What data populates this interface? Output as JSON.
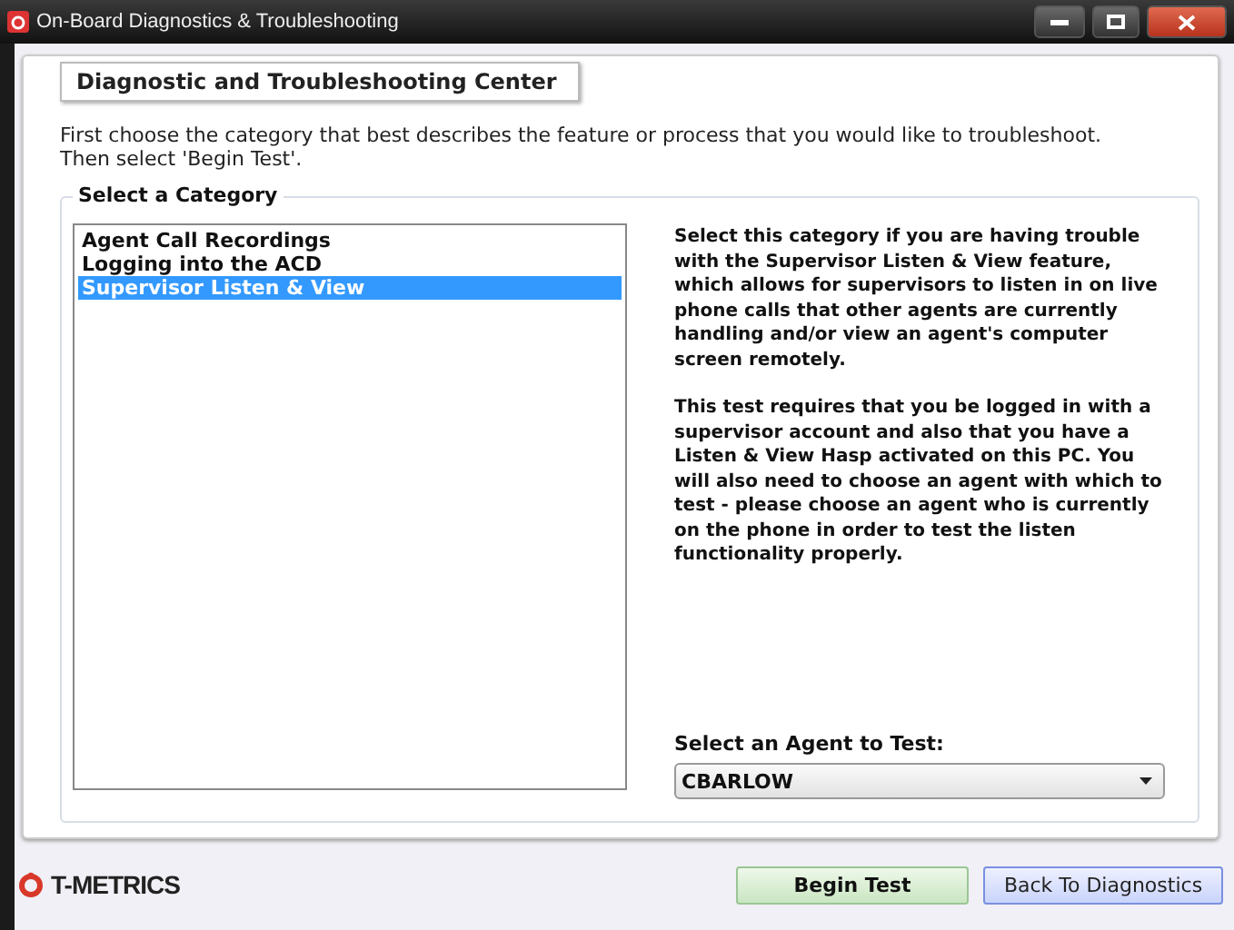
{
  "window": {
    "title": "On-Board Diagnostics & Troubleshooting"
  },
  "tab": {
    "label": "Diagnostic and Troubleshooting Center"
  },
  "intro": "First choose the category that best describes the feature or process that you would like to troubleshoot. Then select 'Begin Test'.",
  "category_group": {
    "title": "Select a Category",
    "items": [
      {
        "label": "Agent Call Recordings",
        "selected": false
      },
      {
        "label": "Logging into the ACD",
        "selected": false
      },
      {
        "label": "Supervisor Listen & View",
        "selected": true
      }
    ],
    "description": [
      "Select this category if you are having trouble with the Supervisor Listen & View feature, which allows for supervisors to listen in on live phone calls that other agents are currently handling and/or view an agent's computer screen remotely.",
      "This test requires that you be logged in with a supervisor account and also that you have a Listen & View Hasp activated on this PC.  You will also need to choose an agent with which to test - please choose an agent who is currently on the phone in order to test the listen functionality properly."
    ],
    "agent_label": "Select an Agent to Test:",
    "agent_value": "CBARLOW"
  },
  "footer": {
    "logo": "T-METRICS",
    "buttons": [
      {
        "label": "Begin Test",
        "kind": "primary"
      },
      {
        "label": "Back To Diagnostics",
        "kind": "secondary"
      }
    ]
  }
}
